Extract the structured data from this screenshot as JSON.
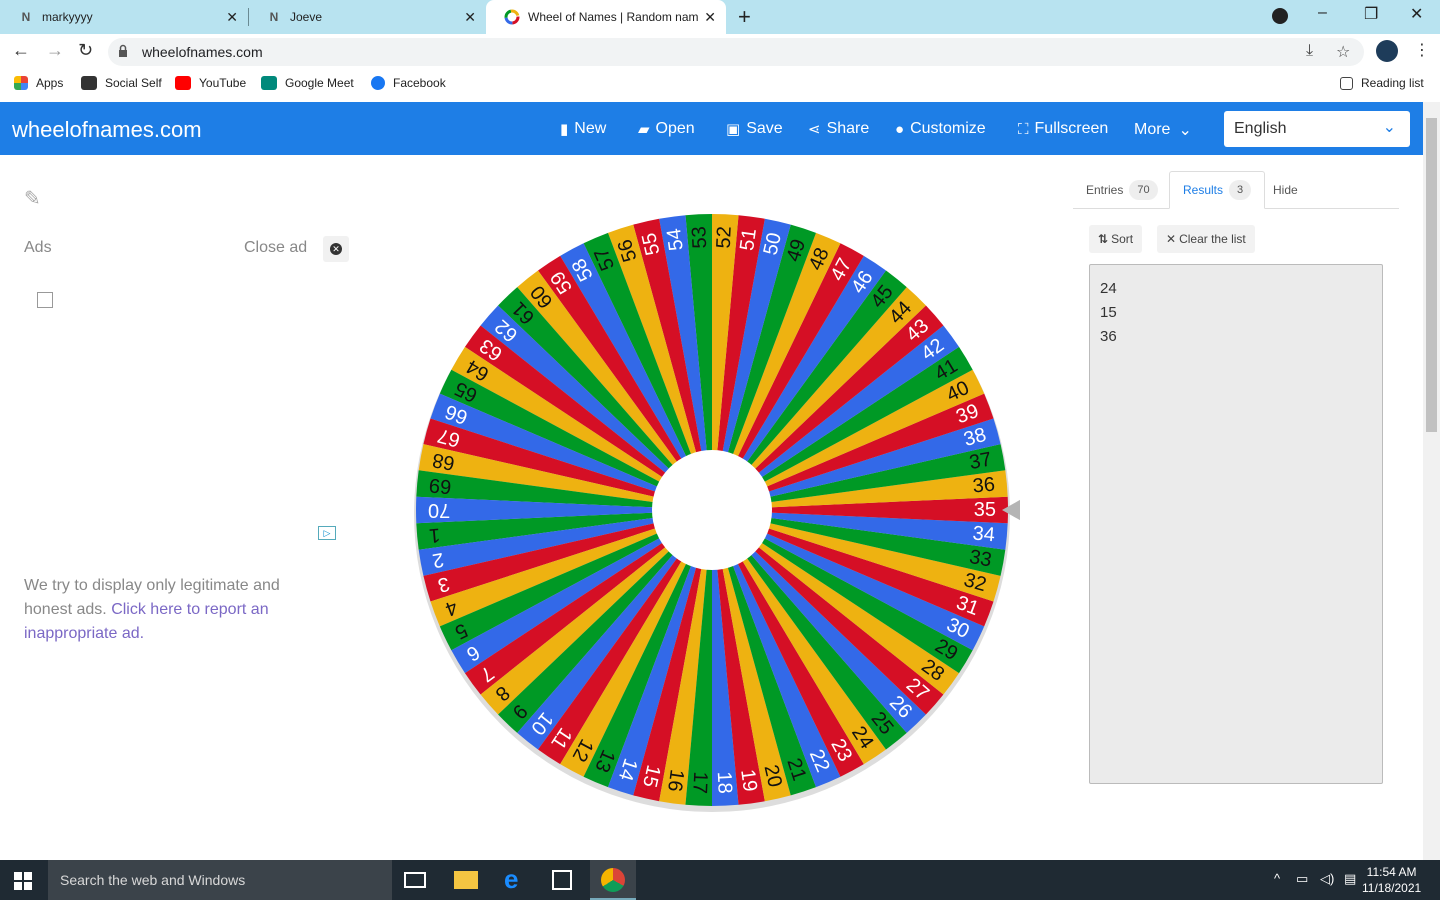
{
  "browser": {
    "tabs": [
      {
        "title": "markyyyy",
        "favicon": "N"
      },
      {
        "title": "Joeve",
        "favicon": "N"
      },
      {
        "title": "Wheel of Names | Random name",
        "favicon": "wheel"
      }
    ],
    "url": "wheelofnames.com",
    "bookmarks": [
      "Apps",
      "Social Self",
      "YouTube",
      "Google Meet",
      "Facebook"
    ],
    "reading_list": "Reading list"
  },
  "app": {
    "brand": "wheelofnames.com",
    "nav": {
      "new": "New",
      "open": "Open",
      "save": "Save",
      "share": "Share",
      "customize": "Customize",
      "fullscreen": "Fullscreen",
      "more": "More"
    },
    "language": "English",
    "colors": {
      "header": "#1e7ee6",
      "wheel": [
        "#3369e8",
        "#d50f25",
        "#eeb211",
        "#009925"
      ]
    }
  },
  "ads": {
    "label": "Ads",
    "close": "Close ad",
    "note": "We try to display only legitimate and honest ads.",
    "report_link": "Click here to report an inappropriate ad."
  },
  "wheel": {
    "entries": [
      "1",
      "2",
      "3",
      "4",
      "5",
      "6",
      "7",
      "8",
      "9",
      "10",
      "11",
      "12",
      "13",
      "14",
      "15",
      "16",
      "17",
      "18",
      "19",
      "20",
      "21",
      "22",
      "23",
      "24",
      "25",
      "26",
      "27",
      "28",
      "29",
      "30",
      "31",
      "32",
      "33",
      "34",
      "35",
      "36",
      "37",
      "38",
      "39",
      "40",
      "41",
      "42",
      "43",
      "44",
      "45",
      "46",
      "47",
      "48",
      "49",
      "50",
      "51",
      "52",
      "53",
      "54",
      "55",
      "56",
      "57",
      "58",
      "59",
      "60",
      "61",
      "62",
      "63",
      "64",
      "65",
      "66",
      "67",
      "68",
      "69",
      "70"
    ]
  },
  "panel": {
    "tabs": {
      "entries": "Entries",
      "entries_count": "70",
      "results": "Results",
      "results_count": "3",
      "hide": "Hide"
    },
    "sort": "Sort",
    "clear": "Clear the list",
    "results": [
      "24",
      "15",
      "36"
    ]
  },
  "taskbar": {
    "search_placeholder": "Search the web and Windows",
    "time": "11:54 AM",
    "date": "11/18/2021"
  }
}
